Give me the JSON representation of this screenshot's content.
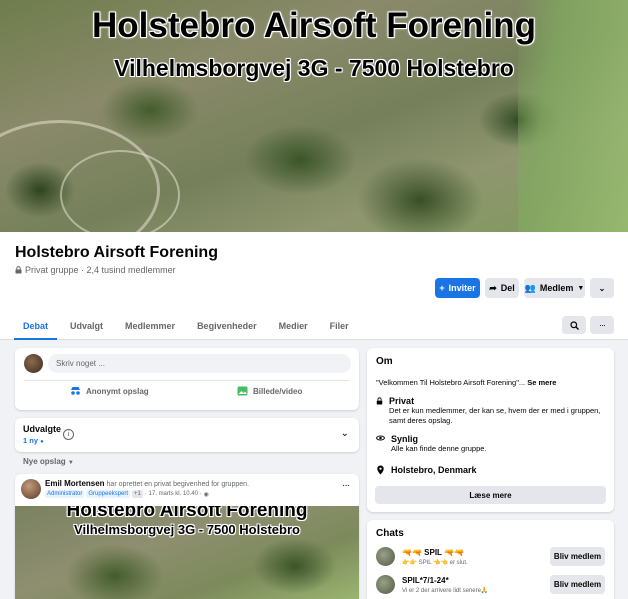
{
  "cover": {
    "title": "Holstebro Airsoft Forening",
    "subtitle": "Vilhelmsborgvej 3G - 7500 Holstebro"
  },
  "group": {
    "name": "Holstebro Airsoft Forening",
    "meta": "Privat gruppe · 2,4 tusind medlemmer"
  },
  "actions": {
    "invite": "Inviter",
    "share": "Del",
    "member": "Medlem"
  },
  "tabs": [
    "Debat",
    "Udvalgt",
    "Medlemmer",
    "Begivenheder",
    "Medier",
    "Filer"
  ],
  "composer": {
    "placeholder": "Skriv noget ...",
    "anon": "Anonymt opslag",
    "photo": "Billede/video"
  },
  "featured": {
    "title": "Udvalgte",
    "count": "1 ny"
  },
  "sort": {
    "label": "Nye opslag"
  },
  "post": {
    "author": "Emil Mortensen",
    "action": "har oprettet en privat begivenhed for gruppen.",
    "badges": [
      "Administrator",
      "Gruppeekspert",
      "+1"
    ],
    "time": "· 17. marts kl. 10.40 ·",
    "image_title": "Holstebro Airsoft Forening",
    "image_subtitle": "Vilhelmsborgvej 3G - 7500 Holstebro"
  },
  "about": {
    "heading": "Om",
    "quote": "\"Velkommen Til Holstebro Airsoft Forening\"...",
    "see_more": "Se mere",
    "private_title": "Privat",
    "private_desc": "Det er kun medlemmer, der kan se, hvem der er med i gruppen, samt deres opslag.",
    "visible_title": "Synlig",
    "visible_desc": "Alle kan finde denne gruppe.",
    "location": "Holstebro, Denmark",
    "learn_more": "Læse mere"
  },
  "chats": {
    "heading": "Chats",
    "items": [
      {
        "name": "🔫🔫 SPIL 🔫🔫",
        "sub": "👉👉 SPIL 👈👈 er slut.",
        "button": "Bliv medlem"
      },
      {
        "name": "SPIL*7/1-24*",
        "sub": "Vi er 2 der arrivere lidt senere🙏",
        "button": "Bliv medlem"
      }
    ]
  }
}
